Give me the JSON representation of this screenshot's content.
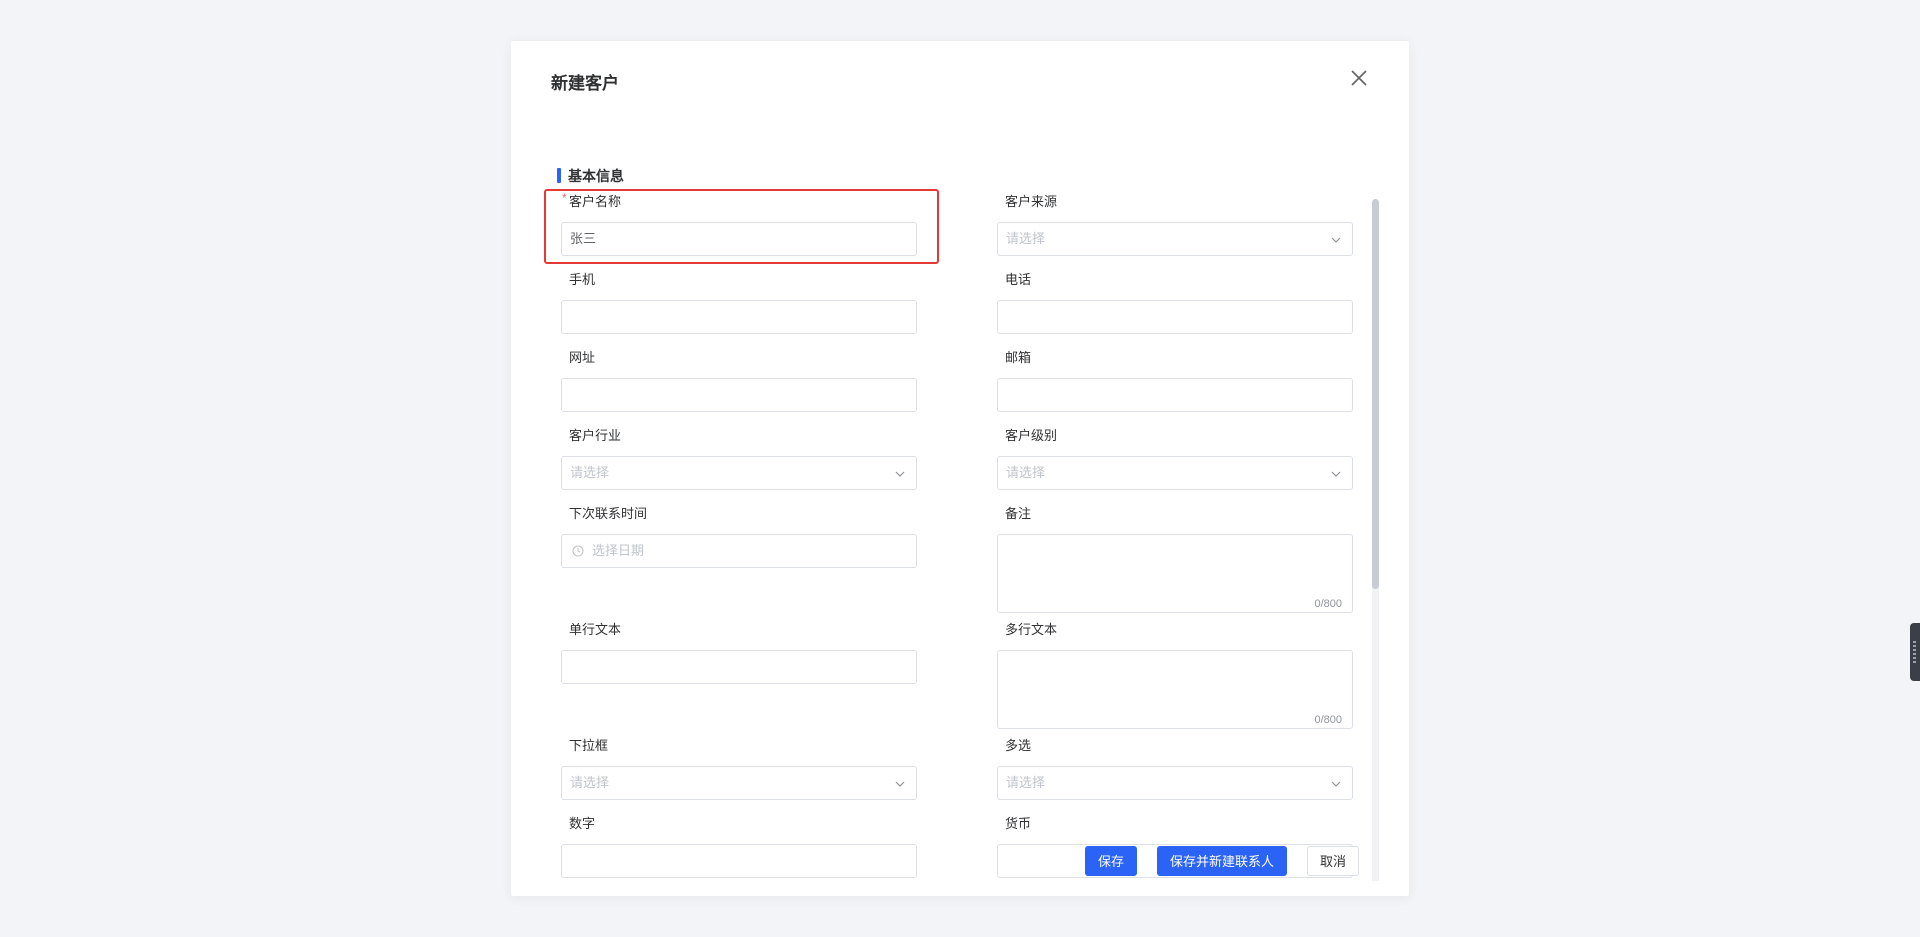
{
  "modal": {
    "title": "新建客户"
  },
  "section": {
    "title": "基本信息"
  },
  "fields": {
    "customer_name": {
      "label": "客户名称",
      "required": "*",
      "value": "张三"
    },
    "customer_source": {
      "label": "客户来源",
      "placeholder": "请选择"
    },
    "mobile": {
      "label": "手机",
      "value": ""
    },
    "phone": {
      "label": "电话",
      "value": ""
    },
    "website": {
      "label": "网址",
      "value": ""
    },
    "email": {
      "label": "邮箱",
      "value": ""
    },
    "industry": {
      "label": "客户行业",
      "placeholder": "请选择"
    },
    "level": {
      "label": "客户级别",
      "placeholder": "请选择"
    },
    "next_contact": {
      "label": "下次联系时间",
      "placeholder": "选择日期"
    },
    "remark": {
      "label": "备注",
      "counter": "0/800"
    },
    "single_text": {
      "label": "单行文本",
      "value": ""
    },
    "multi_text": {
      "label": "多行文本",
      "counter": "0/800"
    },
    "dropdown": {
      "label": "下拉框",
      "placeholder": "请选择"
    },
    "multi_select": {
      "label": "多选",
      "placeholder": "请选择"
    },
    "number": {
      "label": "数字",
      "value": ""
    },
    "currency": {
      "label": "货币",
      "value": ""
    }
  },
  "footer": {
    "save_label": "保存",
    "save_new_contact_label": "保存并新建联系人",
    "cancel_label": "取消"
  },
  "colors": {
    "primary": "#2a63f5",
    "highlight": "#e53935",
    "required": "#f56c6c"
  }
}
